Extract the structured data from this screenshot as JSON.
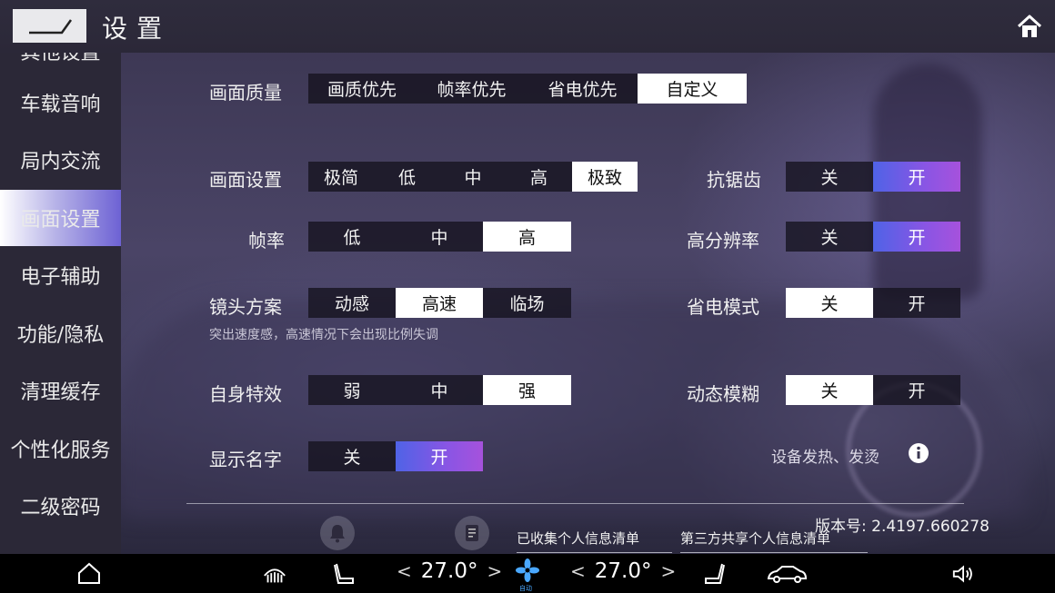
{
  "header": {
    "title": "设置",
    "back_icon": "back-icon",
    "home_icon": "home-icon"
  },
  "sidebar": {
    "items": [
      {
        "label": "其他设置",
        "active": false
      },
      {
        "label": "车载音响",
        "active": false
      },
      {
        "label": "局内交流",
        "active": false
      },
      {
        "label": "画面设置",
        "active": true
      },
      {
        "label": "电子辅助",
        "active": false
      },
      {
        "label": "功能/隐私",
        "active": false
      },
      {
        "label": "清理缓存",
        "active": false
      },
      {
        "label": "个性化服务",
        "active": false
      },
      {
        "label": "二级密码",
        "active": false
      }
    ]
  },
  "settings": {
    "quality": {
      "label": "画面质量",
      "options": [
        "画质优先",
        "帧率优先",
        "省电优先",
        "自定义"
      ],
      "selected": 3
    },
    "graphics": {
      "label": "画面设置",
      "options": [
        "极简",
        "低",
        "中",
        "高",
        "极致"
      ],
      "selected": 4
    },
    "framerate": {
      "label": "帧率",
      "options": [
        "低",
        "中",
        "高"
      ],
      "selected": 2
    },
    "camera": {
      "label": "镜头方案",
      "options": [
        "动感",
        "高速",
        "临场"
      ],
      "selected": 1,
      "hint": "突出速度感，高速情况下会出现比例失调"
    },
    "self_effect": {
      "label": "自身特效",
      "options": [
        "弱",
        "中",
        "强"
      ],
      "selected": 2
    },
    "show_name": {
      "label": "显示名字",
      "options": [
        "关",
        "开"
      ],
      "selected": 1
    },
    "antialias": {
      "label": "抗锯齿",
      "options": [
        "关",
        "开"
      ],
      "selected": 1
    },
    "high_res": {
      "label": "高分辨率",
      "options": [
        "关",
        "开"
      ],
      "selected": 1
    },
    "power_save": {
      "label": "省电模式",
      "options": [
        "关",
        "开"
      ],
      "selected": 0
    },
    "motion_blur": {
      "label": "动态模糊",
      "options": [
        "关",
        "开"
      ],
      "selected": 0
    },
    "overheat": {
      "label": "设备发热、发烫"
    }
  },
  "footer": {
    "links": [
      "已收集个人信息清单",
      "第三方共享个人信息清单"
    ],
    "version": "版本号: 2.4197.660278"
  },
  "bottom_bar": {
    "left_temp": "27.0°",
    "right_temp": "27.0°",
    "fan_mode": "自动"
  },
  "colors": {
    "accent_gradient_start": "#4f63e6",
    "accent_gradient_end": "#a652dc",
    "selected_white": "#ffffff",
    "sidebar_bg": "#2b2837"
  }
}
